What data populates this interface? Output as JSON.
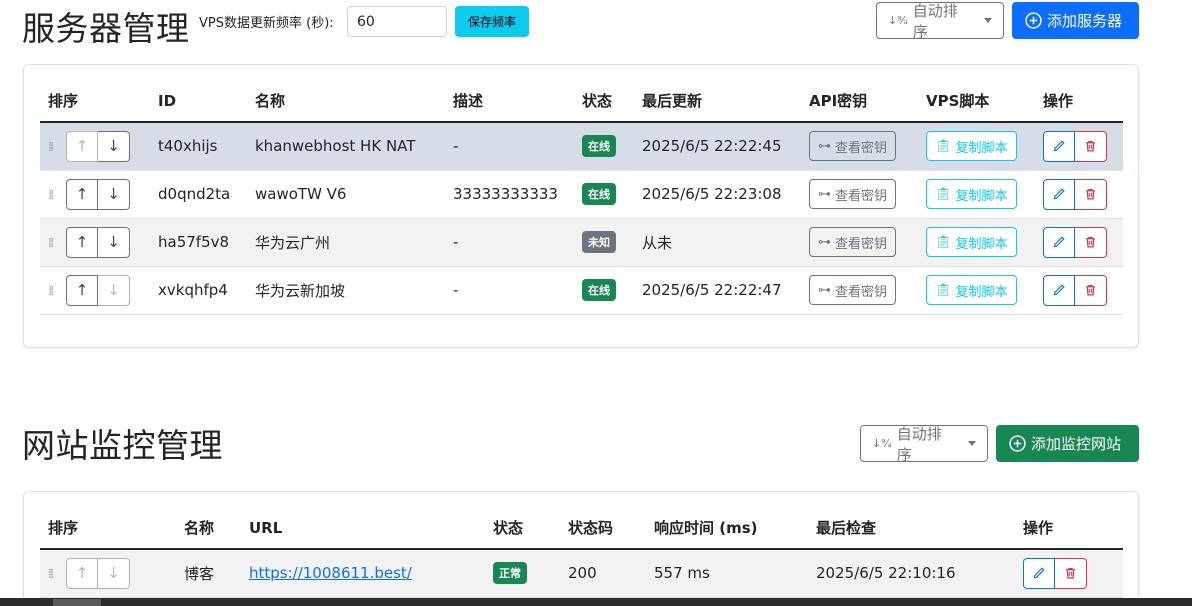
{
  "servers": {
    "title": "服务器管理",
    "freq_label": "VPS数据更新频率 (秒):",
    "freq_value": "60",
    "save_freq_label": "保存频率",
    "sort_label": "自动排序",
    "add_label": "添加服务器",
    "headers": [
      "排序",
      "ID",
      "名称",
      "描述",
      "状态",
      "最后更新",
      "API密钥",
      "VPS脚本",
      "操作"
    ],
    "rows": [
      {
        "id": "t40xhijs",
        "name": "khanwebhost HK NAT",
        "desc": "-",
        "status": "在线",
        "status_color": "#198754",
        "updated": "2025/6/5 22:22:45",
        "key_label": "查看密钥",
        "script_label": "复制脚本"
      },
      {
        "id": "d0qnd2ta",
        "name": "wawoTW V6",
        "desc": "33333333333",
        "status": "在线",
        "status_color": "#198754",
        "updated": "2025/6/5 22:23:08",
        "key_label": "查看密钥",
        "script_label": "复制脚本"
      },
      {
        "id": "ha57f5v8",
        "name": "华为云广州",
        "desc": "-",
        "status": "未知",
        "status_color": "#6c757d",
        "updated": "从未",
        "key_label": "查看密钥",
        "script_label": "复制脚本"
      },
      {
        "id": "xvkqhfp4",
        "name": "华为云新加坡",
        "desc": "-",
        "status": "在线",
        "status_color": "#198754",
        "updated": "2025/6/5 22:22:47",
        "key_label": "查看密钥",
        "script_label": "复制脚本"
      }
    ]
  },
  "sites": {
    "title": "网站监控管理",
    "sort_label": "自动排序",
    "add_label": "添加监控网站",
    "headers": [
      "排序",
      "名称",
      "URL",
      "状态",
      "状态码",
      "响应时间 (ms)",
      "最后检查",
      "操作"
    ],
    "rows": [
      {
        "name": "博客",
        "url": "https://1008611.best/",
        "status": "正常",
        "status_color": "#198754",
        "code": "200",
        "response": "557 ms",
        "checked": "2025/6/5 22:10:16"
      }
    ]
  },
  "colors": {
    "primary": "#0d6efd",
    "success": "#198754",
    "info": "#0dcaf0",
    "danger": "#dc3545",
    "secondary": "#6c757d"
  }
}
